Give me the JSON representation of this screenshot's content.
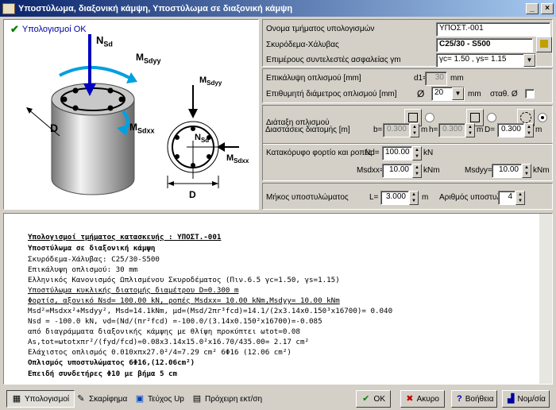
{
  "window": {
    "title": "Υποστύλωμα, διαξονική κάμψη, Υποστύλωμα σε διαξονική κάμψη",
    "min": "_",
    "close": "×"
  },
  "status": {
    "calc_ok": "Υπολογισμοί OK"
  },
  "figure": {
    "nsd": "N",
    "nsd_sub": "Sd",
    "msdyy": "M",
    "msdyy_sub": "Sdyy",
    "msdxx": "M",
    "msdxx_sub": "Sdxx",
    "d_label": "D",
    "d_label2": "D",
    "fig2_msdyy": "M",
    "fig2_msdyy_sub": "Sdyy",
    "fig2_nsd": "N",
    "fig2_nsd_sub": "Sd",
    "fig2_msdxx": "M",
    "fig2_msdxx_sub": "Sdxx"
  },
  "form": {
    "section_name_label": "Ονομα τμήματος υπολογισμών",
    "section_name_value": "ΥΠΟΣΤ.-001",
    "material_label": "Σκυρόδεμα-Χάλυβας",
    "material_value": "C25/30 - S500",
    "safety_label": "Επιμέρους συντελεστές ασφαλείας γm",
    "safety_value": "γc= 1.50 , γs= 1.15",
    "cover_label": "Επικάλυψη οπλισμού [mm]",
    "cover_d1": "d1=",
    "cover_value": "30",
    "cover_unit": "mm",
    "bar_label": "Επιθυμητή διάμετρος οπλισμού [mm]",
    "bar_symbol": "Ø",
    "bar_value": "20",
    "bar_unit": "mm",
    "bar_const": "σταθ. Ø",
    "arrangement_label": "Διάταξη οπλισμού",
    "dims_label": "Διαστάσεις διατομής [m]",
    "b_label": "b=",
    "b_value": "0.300",
    "b_unit": "m",
    "h_label": "h=",
    "h_value": "0.300",
    "h_unit": "m",
    "d_label": "D=",
    "d_value": "0.300",
    "d_unit": "m",
    "loads_label": "Κατακόρυφο φορτίο και ροπές",
    "nd_label": "Nd=",
    "nd_value": "100.00",
    "nd_unit": "kN",
    "msdxx_label": "Msdxx=",
    "msdxx_value": "10.00",
    "msdxx_unit": "kNm",
    "msdyy_label": "Msdyy=",
    "msdyy_value": "10.00",
    "msdyy_unit": "kNm",
    "length_label": "Μήκος υποστυλώματος",
    "l_label": "L=",
    "l_value": "3.000",
    "l_unit": "m",
    "count_label": "Αριθμός υποστυλ.",
    "count_value": "4"
  },
  "report": [
    {
      "text": "Υπολογισμοί τμήματος κατασκευής : ΥΠΟΣΤ.-001",
      "style": "bu"
    },
    {
      "text": "Υποστύλωμα σε διαξονική κάμψη",
      "style": "b"
    },
    {
      "text": "Σκυρόδεμα-Χάλυβας: C25/30-S500",
      "style": ""
    },
    {
      "text": "Επικάλυψη οπλισμού: 30 mm",
      "style": ""
    },
    {
      "text": "Ελληνικός Κανονισμός Ωπλισμένου Σκυροδέματος (Πιν.6.5 γc=1.50, γs=1.15)",
      "style": ""
    },
    {
      "text": "Υποστύλωμα κυκλικής διατομής διαμέτρου D=0.300 m",
      "style": "u"
    },
    {
      "text": "Φορτίσ, αξονικό Nsd= 100.00 kN, ροπές Msdxx=  10.00 kNm,Msdyy=  10.00 kNm",
      "style": "u"
    },
    {
      "text": "Msd²=Msdxx²+Msdyy², Msd=14.1kNm, μd=(Msd/2πr³fcd)=14.1/(2x3.14x0.150³x16700)= 0.040",
      "style": ""
    },
    {
      "text": "Nsd  = -100.0 kN,  νd=(Nd/(πr²fcd)  =-100.0/(3.14x0.150²x16700)=-0.085",
      "style": ""
    },
    {
      "text": "από διαγράμματα διαξονικής κάμψης με θλίψη προκύπτει ωtot=0.08",
      "style": ""
    },
    {
      "text": "As,tot=ωtotxπr²/(fyd/fcd)=0.08x3.14x15.0²x16.70/435.00=  2.17 cm²",
      "style": ""
    },
    {
      "text": "Ελάχιστος οπλισμός 0.010xπx27.0²/4=7.29 cm² 6Φ16 (12.06 cm²)",
      "style": ""
    },
    {
      "text": "Οπλισμός υποστυλώματος 6Φ16,(12.06cm²)",
      "style": "b"
    },
    {
      "text": "Επειδή  συνδετήρες Φ10 με βήμα 5 cm",
      "style": "b"
    }
  ],
  "buttons": {
    "calc": "Υπολογισμοί",
    "sketch": "Σκαρίφημα",
    "print": "Τεύχος Up",
    "draft": "Πρόχειρη εκτ/ση",
    "ok": "ΟΚ",
    "cancel": "Ακυρο",
    "help": "Βοήθεια",
    "units": "Νομ/σία"
  },
  "colors": {
    "title_from": "#0a246a",
    "title_to": "#a6caf0",
    "arrow_blue": "#0000c0",
    "moment_cyan": "#00a0e0"
  }
}
